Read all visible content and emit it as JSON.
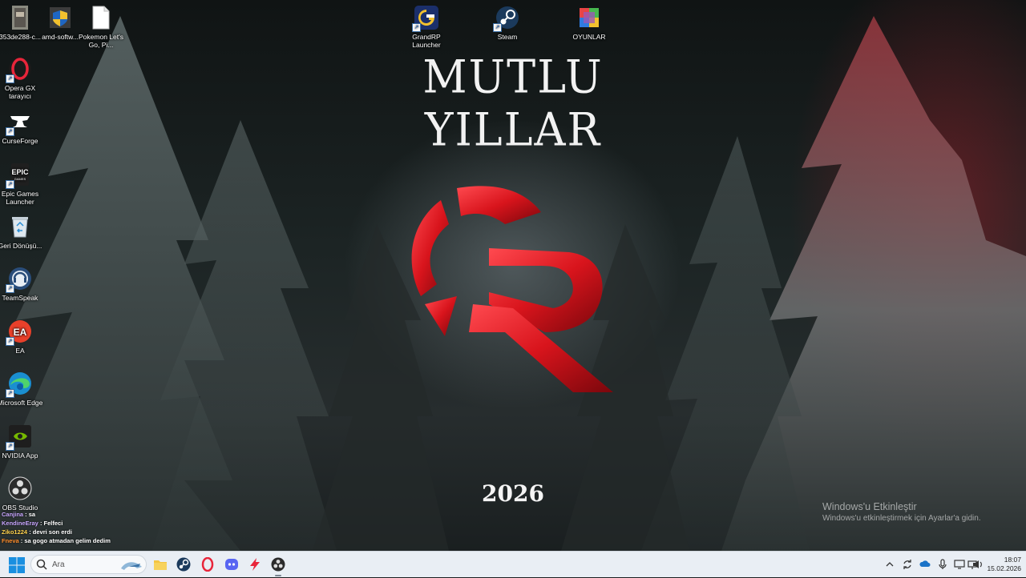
{
  "wallpaper": {
    "title": "MUTLU YILLAR",
    "year": "2026",
    "logo_primary_color": "#d8141c"
  },
  "desktop_icons": [
    {
      "label": "353de288-c...",
      "icon": "file-thumbnail-icon"
    },
    {
      "label": "amd-softw...",
      "icon": "installer-shield-icon"
    },
    {
      "label": "Pokemon Let's Go, Pi...",
      "icon": "document-icon"
    },
    {
      "label": "GrandRP Launcher",
      "icon": "grandrp-icon"
    },
    {
      "label": "Steam",
      "icon": "steam-icon"
    },
    {
      "label": "OYUNLAR",
      "icon": "games-folder-icon"
    },
    {
      "label": "Opera GX tarayıcı",
      "icon": "opera-gx-icon"
    },
    {
      "label": "CurseForge",
      "icon": "curseforge-icon"
    },
    {
      "label": "Epic Games Launcher",
      "icon": "epic-games-icon"
    },
    {
      "label": "Geri Dönüşü...",
      "icon": "recycle-bin-icon"
    },
    {
      "label": "TeamSpeak",
      "icon": "teamspeak-icon"
    },
    {
      "label": "EA",
      "icon": "ea-icon"
    },
    {
      "label": "Microsoft Edge",
      "icon": "edge-icon"
    },
    {
      "label": "NVIDIA App",
      "icon": "nvidia-icon"
    },
    {
      "label": "OBS Studio",
      "icon": "obs-icon"
    }
  ],
  "chat": [
    {
      "user": "Canjina",
      "message": "sa"
    },
    {
      "user": "KendineEray",
      "message": "Felfeci"
    },
    {
      "user": "Ziko1224",
      "message": "devri son erdi"
    },
    {
      "user": "Fneva",
      "message": "sa gogo atmadan gelim dedim"
    }
  ],
  "watermark": {
    "line1": "Windows'u Etkinleştir",
    "line2": "Windows'u etkinleştirmek için Ayarlar'a gidin."
  },
  "taskbar": {
    "search_placeholder": "Ara",
    "apps": [
      {
        "name": "file-explorer-icon"
      },
      {
        "name": "steam-icon"
      },
      {
        "name": "opera-gx-icon"
      },
      {
        "name": "discord-icon"
      },
      {
        "name": "lightning-app-icon"
      },
      {
        "name": "obs-icon",
        "active": true
      }
    ],
    "tray": [
      "show-hidden-icons-icon",
      "sync-icon",
      "cloud-icon",
      "microphone-icon",
      "display-icon",
      "network-icon",
      "volume-icon"
    ],
    "time": "18:07",
    "date": "15.02.2026"
  }
}
